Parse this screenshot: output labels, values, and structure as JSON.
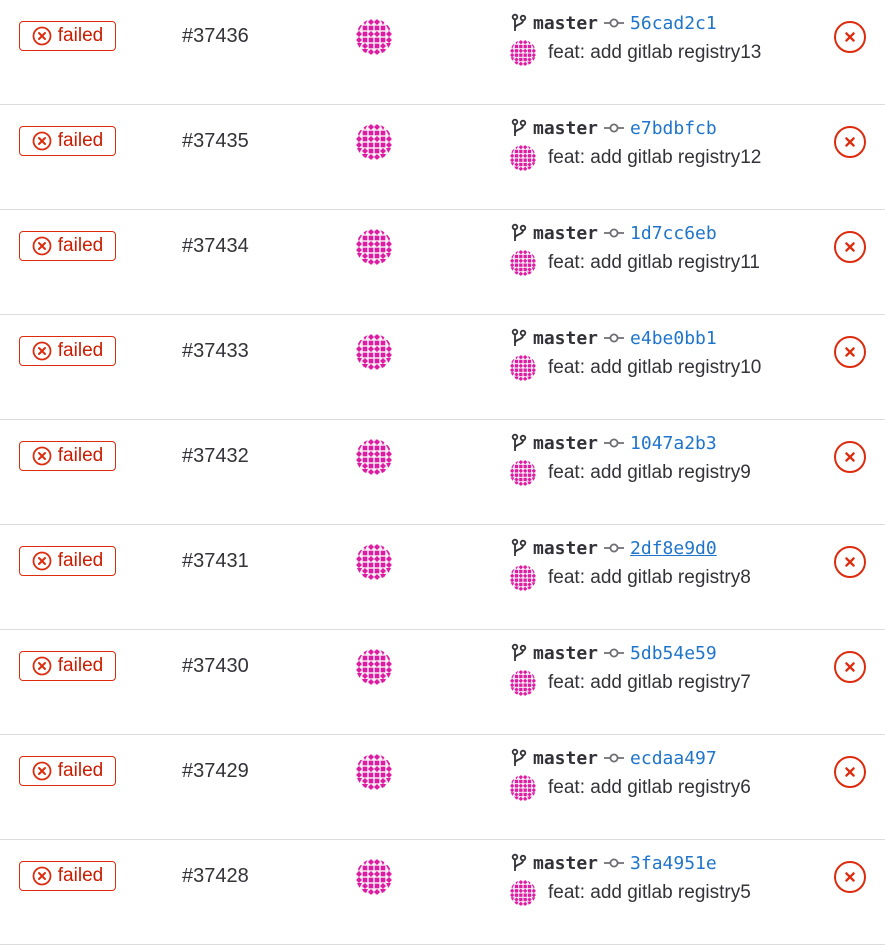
{
  "colors": {
    "failed": "#dd2b0e",
    "failed_text": "#c91c00",
    "link": "#1f75cb",
    "avatar": "#e01ba3",
    "divider": "#dcdcde"
  },
  "pipelines": [
    {
      "status": "failed",
      "id": "#37436",
      "branch": "master",
      "sha": "56cad2c1",
      "title": "feat: add gitlab registry13"
    },
    {
      "status": "failed",
      "id": "#37435",
      "branch": "master",
      "sha": "e7bdbfcb",
      "title": "feat: add gitlab registry12"
    },
    {
      "status": "failed",
      "id": "#37434",
      "branch": "master",
      "sha": "1d7cc6eb",
      "title": "feat: add gitlab registry11"
    },
    {
      "status": "failed",
      "id": "#37433",
      "branch": "master",
      "sha": "e4be0bb1",
      "title": "feat: add gitlab registry10"
    },
    {
      "status": "failed",
      "id": "#37432",
      "branch": "master",
      "sha": "1047a2b3",
      "title": "feat: add gitlab registry9"
    },
    {
      "status": "failed",
      "id": "#37431",
      "branch": "master",
      "sha": "2df8e9d0",
      "title": "feat: add gitlab registry8"
    },
    {
      "status": "failed",
      "id": "#37430",
      "branch": "master",
      "sha": "5db54e59",
      "title": "feat: add gitlab registry7"
    },
    {
      "status": "failed",
      "id": "#37429",
      "branch": "master",
      "sha": "ecdaa497",
      "title": "feat: add gitlab registry6"
    },
    {
      "status": "failed",
      "id": "#37428",
      "branch": "master",
      "sha": "3fa4951e",
      "title": "feat: add gitlab registry5"
    }
  ],
  "icons": {
    "status": "failed-status-icon",
    "branch": "branch-icon",
    "commit": "commit-icon",
    "avatar": "identicon-avatar",
    "action": "failed-status-icon"
  }
}
